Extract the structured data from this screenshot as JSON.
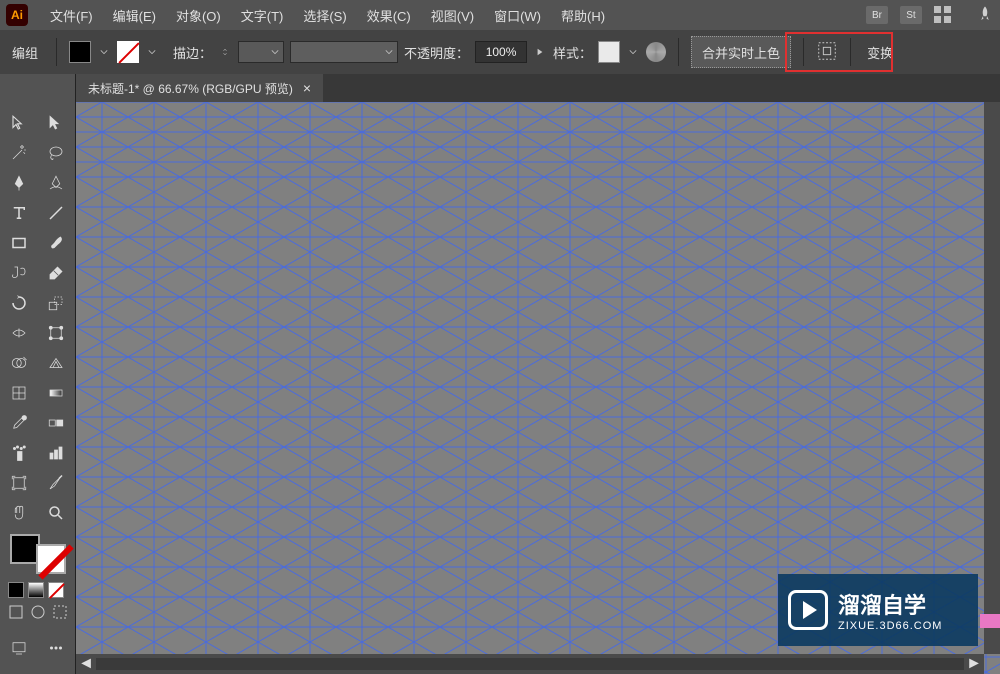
{
  "app": {
    "icon_label": "Ai"
  },
  "menu": {
    "file": "文件(F)",
    "edit": "编辑(E)",
    "object": "对象(O)",
    "text": "文字(T)",
    "select": "选择(S)",
    "effect": "效果(C)",
    "view": "视图(V)",
    "window": "窗口(W)",
    "help": "帮助(H)"
  },
  "menubar_right": {
    "br": "Br",
    "st": "St"
  },
  "controlbar": {
    "group": "编组",
    "stroke_label": "描边：",
    "opacity_label": "不透明度：",
    "opacity_value": "100%",
    "style_label": "样式：",
    "merge_live_paint": "合并实时上色",
    "transform": "变换"
  },
  "tab": {
    "title": "未标题-1* @ 66.67% (RGB/GPU 预览)",
    "close": "×"
  },
  "watermark": {
    "title": "溜溜自学",
    "url": "ZIXUE.3D66.COM"
  },
  "tools": {
    "selection": "selection-tool",
    "direct": "direct-selection-tool",
    "magic_wand": "magic-wand-tool",
    "lasso": "lasso-tool",
    "pen": "pen-tool",
    "curvature": "curvature-tool",
    "type": "type-tool",
    "line": "line-tool",
    "rect": "rectangle-tool",
    "brush": "paintbrush-tool",
    "shaper": "shaper-tool",
    "eraser": "eraser-tool",
    "rotate": "rotate-tool",
    "scale": "scale-tool",
    "width": "width-tool",
    "free_transform": "free-transform-tool",
    "shape_builder": "shape-builder-tool",
    "perspective": "perspective-grid-tool",
    "mesh": "mesh-tool",
    "gradient": "gradient-tool",
    "eyedropper": "eyedropper-tool",
    "blend": "blend-tool",
    "symbol_sprayer": "symbol-sprayer-tool",
    "column_graph": "column-graph-tool",
    "artboard": "artboard-tool",
    "slice": "slice-tool",
    "hand": "hand-tool",
    "zoom": "zoom-tool"
  }
}
